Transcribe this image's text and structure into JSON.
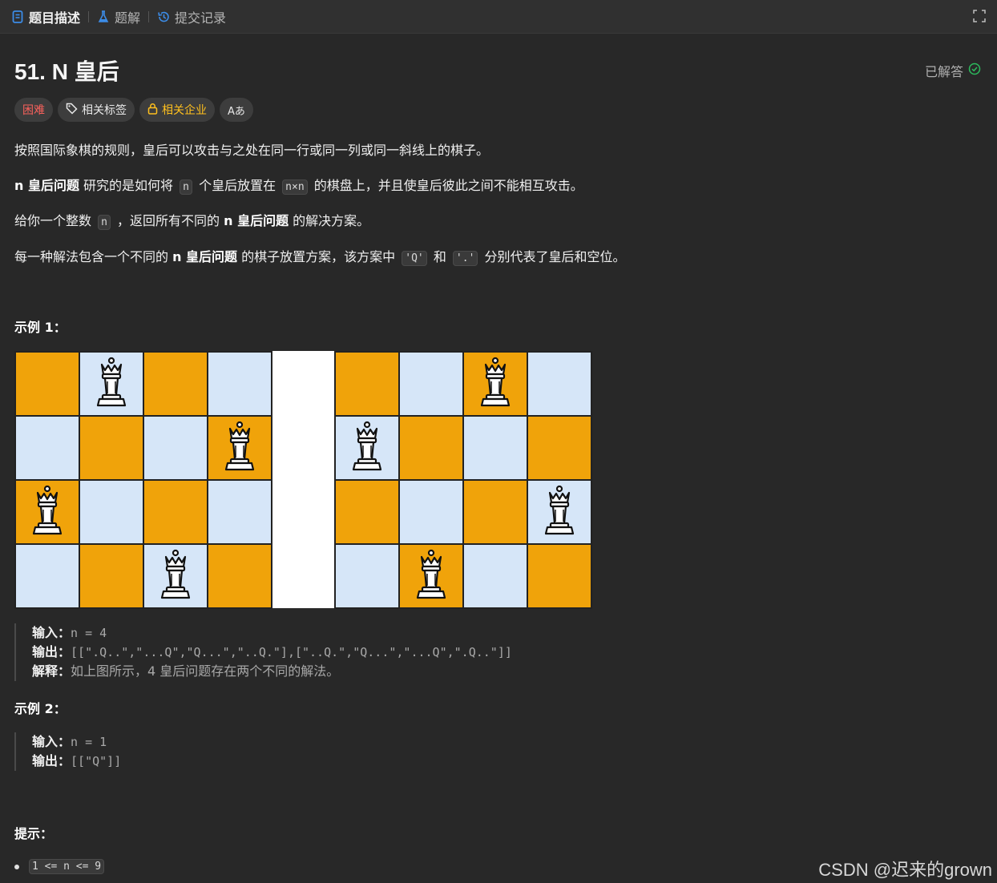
{
  "tabs": [
    {
      "label": "题目描述",
      "icon": "document-icon",
      "active": true
    },
    {
      "label": "题解",
      "icon": "flask-icon",
      "active": false
    },
    {
      "label": "提交记录",
      "icon": "history-icon",
      "active": false
    }
  ],
  "problem": {
    "title": "51. N 皇后",
    "status": "已解答",
    "tags": {
      "difficulty": "困难",
      "related_tags": "相关标签",
      "related_companies": "相关企业",
      "translate_icon": "Aあ"
    }
  },
  "description": {
    "p1": "按照国际象棋的规则，皇后可以攻击与之处在同一行或同一列或同一斜线上的棋子。",
    "p2": {
      "bold": "n 皇后问题",
      "a": " 研究的是如何将 ",
      "code1": "n",
      "b": " 个皇后放置在 ",
      "code2": "n×n",
      "c": " 的棋盘上，并且使皇后彼此之间不能相互攻击。"
    },
    "p3": {
      "a": "给你一个整数 ",
      "code1": "n",
      "b": " ，返回所有不同的 ",
      "bold": "n 皇后问题",
      "c": " 的解决方案。"
    },
    "p4": {
      "a": "每一种解法包含一个不同的 ",
      "bold": "n 皇后问题",
      "b": " 的棋子放置方案，该方案中 ",
      "code1": "'Q'",
      "c": " 和 ",
      "code2": "'.'",
      "d": " 分别代表了皇后和空位。"
    }
  },
  "example1": {
    "heading": "示例 1：",
    "boards": [
      {
        "queens": [
          [
            0,
            1
          ],
          [
            1,
            3
          ],
          [
            2,
            0
          ],
          [
            3,
            2
          ]
        ]
      },
      {
        "queens": [
          [
            0,
            2
          ],
          [
            1,
            0
          ],
          [
            2,
            3
          ],
          [
            3,
            1
          ]
        ]
      }
    ],
    "input_label": "输入：",
    "input": "n = 4",
    "output_label": "输出：",
    "output": "[[\".Q..\",\"...Q\",\"Q...\",\"..Q.\"],[\"..Q.\",\"Q...\",\"...Q\",\".Q..\"]]",
    "explain_label": "解释：",
    "explain": "如上图所示，4 皇后问题存在两个不同的解法。"
  },
  "example2": {
    "heading": "示例 2：",
    "input_label": "输入：",
    "input": "n = 1",
    "output_label": "输出：",
    "output": "[[\"Q\"]]"
  },
  "constraints": {
    "heading": "提示：",
    "items": [
      "1 <= n <= 9"
    ]
  },
  "watermark": "CSDN @迟来的grown",
  "colors": {
    "orange_square": "#f0a30a",
    "light_square": "#d6e6f8",
    "hard": "#f8615c",
    "company": "#ffc01e",
    "solved_check": "#2cbb5d",
    "tab_active_icon": "#3c8ce7"
  }
}
